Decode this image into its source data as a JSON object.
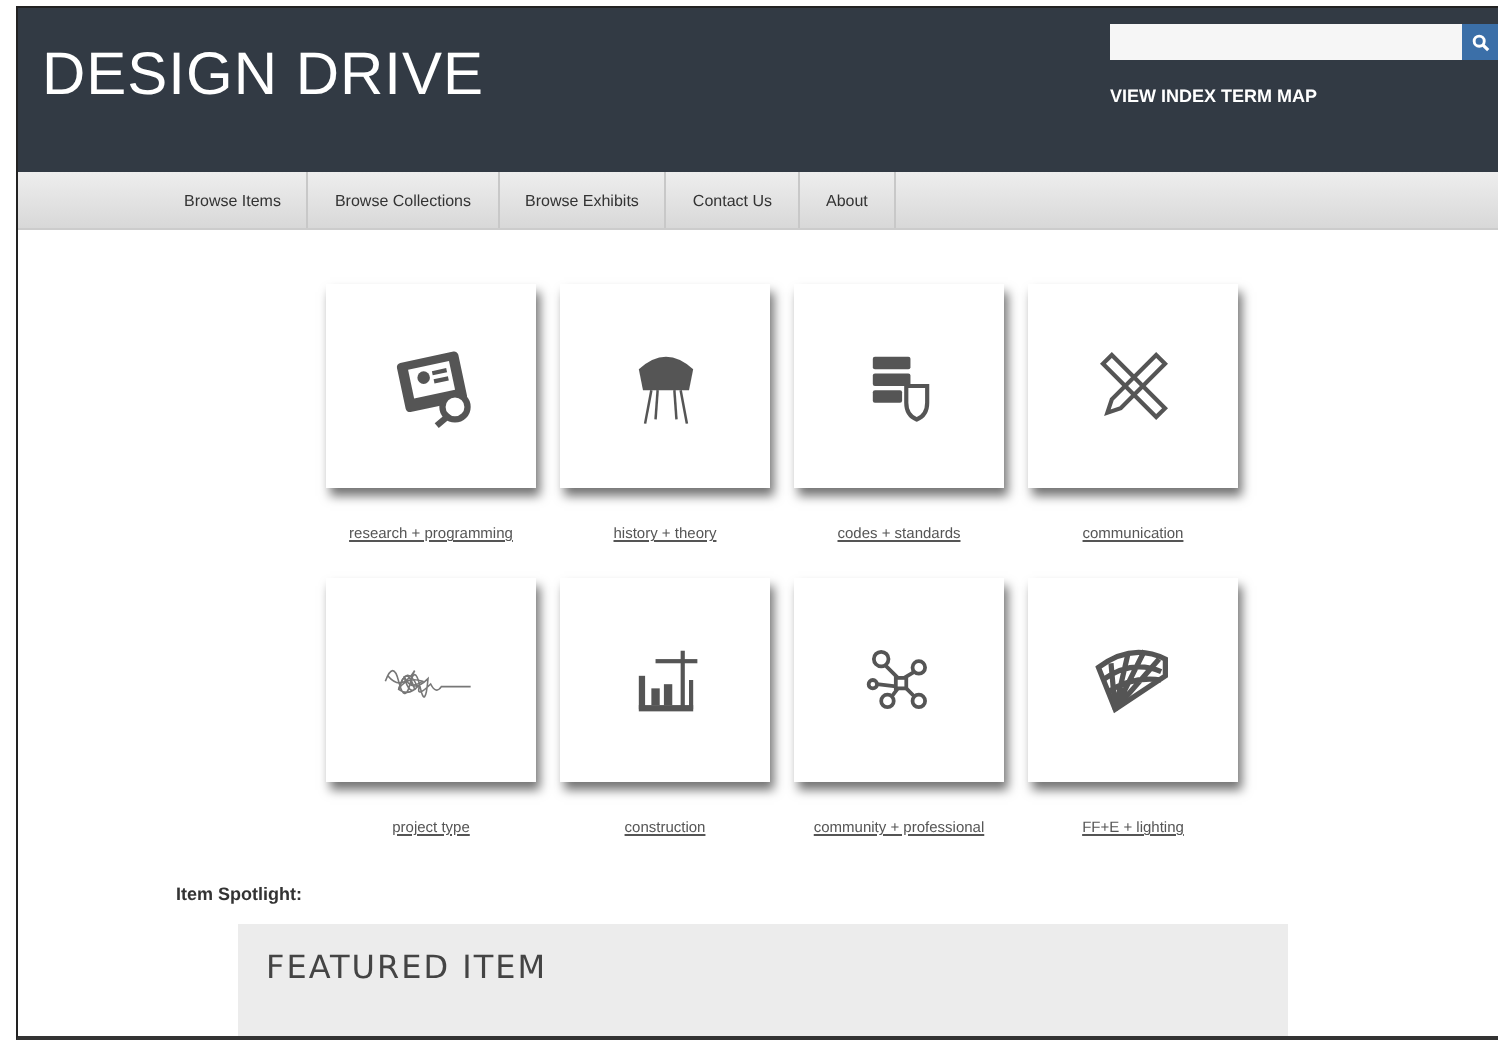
{
  "header": {
    "title": "DESIGN DRIVE",
    "link": "VIEW INDEX TERM MAP"
  },
  "nav": [
    {
      "label": "Browse Items"
    },
    {
      "label": "Browse Collections"
    },
    {
      "label": "Browse Exhibits"
    },
    {
      "label": "Contact Us"
    },
    {
      "label": "About"
    }
  ],
  "categories": [
    {
      "label": "research + programming"
    },
    {
      "label": "history + theory"
    },
    {
      "label": "codes + standards"
    },
    {
      "label": "communication"
    },
    {
      "label": "project type"
    },
    {
      "label": "construction"
    },
    {
      "label": "community + professional"
    },
    {
      "label": "FF+E + lighting"
    }
  ],
  "spotlight": {
    "heading": "Item Spotlight:",
    "featured_title": "FEATURED ITEM"
  }
}
